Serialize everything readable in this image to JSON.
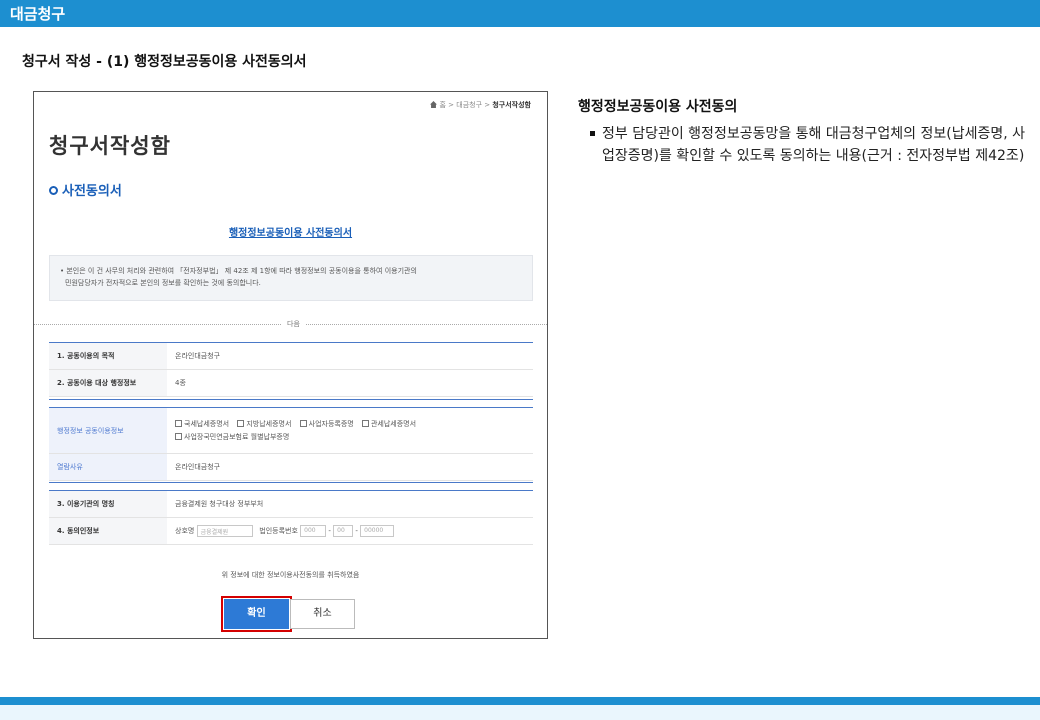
{
  "header": {
    "title": "대금청구"
  },
  "section_title": "청구서 작성 - (1) 행정정보공동이용 사전동의서",
  "screenshot": {
    "breadcrumb": {
      "home": "홈",
      "sep1": ">",
      "item1": "대금청구",
      "sep2": ">",
      "current": "청구서작성함"
    },
    "page_title": "청구서작성함",
    "subheading": "사전동의서",
    "agreement_link": "행정정보공동이용 사전동의서",
    "notice_line1": "• 본인은 이 건 사무의 처리와 관련하여 「전자정부법」 제 42조 제 1항에 따라 행정정보의 공동이용을 통하여 이용기관의",
    "notice_line2": "민원담당자가 전자적으로 본인의 정보를 확인하는 것에 동의합니다.",
    "divider_label": "다음",
    "rows1": [
      {
        "label": "1. 공동이용의 목적",
        "value": "온라인대금청구"
      },
      {
        "label": "2. 공동이용 대상 행정정보",
        "value": "4종"
      }
    ],
    "rows2": {
      "info_label": "행정정보 공동이용정보",
      "checks": [
        "국세납세증명서",
        "지방납세증명서",
        "사업자등록증명",
        "관세납세증명서",
        "사업장국민연금보험료 월별납부증명"
      ],
      "reason_label": "열람사유",
      "reason_value": "온라인대금청구"
    },
    "rows3": [
      {
        "label": "3. 이용기관의 명칭",
        "value": "금융결제원 청구대상 정부부처"
      },
      {
        "label": "4. 동의인정보",
        "company_label": "상호명",
        "company_value": "금융결제원",
        "bizno_label": "법인등록번호",
        "bizno1": "000",
        "dash1": "-",
        "bizno2": "00",
        "dash2": "-",
        "bizno3": "00000"
      }
    ],
    "consent_message": "위 정보에 대한 정보이용사전동의를 취득하였음",
    "confirm_button": "확인",
    "cancel_button": "취소"
  },
  "right_panel": {
    "title": "행정정보공동이용 사전동의",
    "bullet": "정부 담당관이 행정정보공동망을 통해 대금청구업체의 정보(납세증명, 사업장증명)를 확인할 수 있도록 동의하는 내용(근거 : 전자정부법 제42조)"
  },
  "colors": {
    "brand_blue": "#1d8fd0",
    "link_blue": "#1a5fb8",
    "highlight_red": "#d40000"
  },
  "icons": [
    "home-icon",
    "ring-bullet-icon",
    "checkbox-icon",
    "square-bullet-icon"
  ]
}
